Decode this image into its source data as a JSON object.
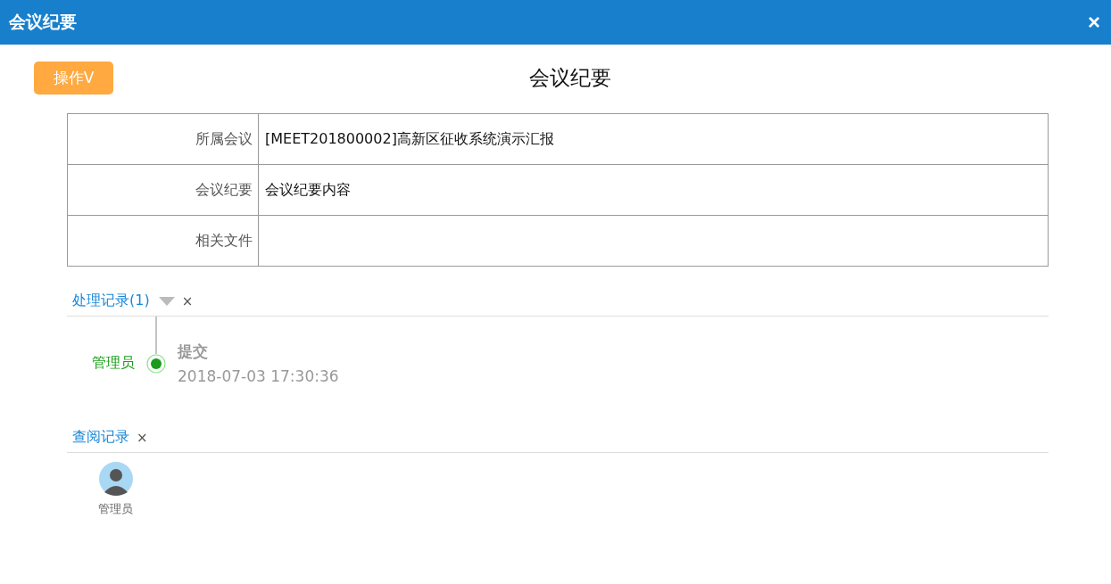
{
  "window": {
    "title": "会议纪要",
    "close": "×"
  },
  "action_button": "操作V",
  "page_title": "会议纪要",
  "form": [
    {
      "label": "所属会议",
      "value": "[MEET201800002]高新区征收系统演示汇报"
    },
    {
      "label": "会议纪要",
      "value": "会议纪要内容"
    },
    {
      "label": "相关文件"
    }
  ],
  "process_log": {
    "title": "处理记录(1)",
    "close": "×",
    "entries": [
      {
        "user": "管理员",
        "action": "提交",
        "time": "2018-07-03 17:30:36"
      }
    ]
  },
  "view_log": {
    "title": "查阅记录",
    "close": "×",
    "viewers": [
      {
        "name": "管理员"
      }
    ]
  }
}
